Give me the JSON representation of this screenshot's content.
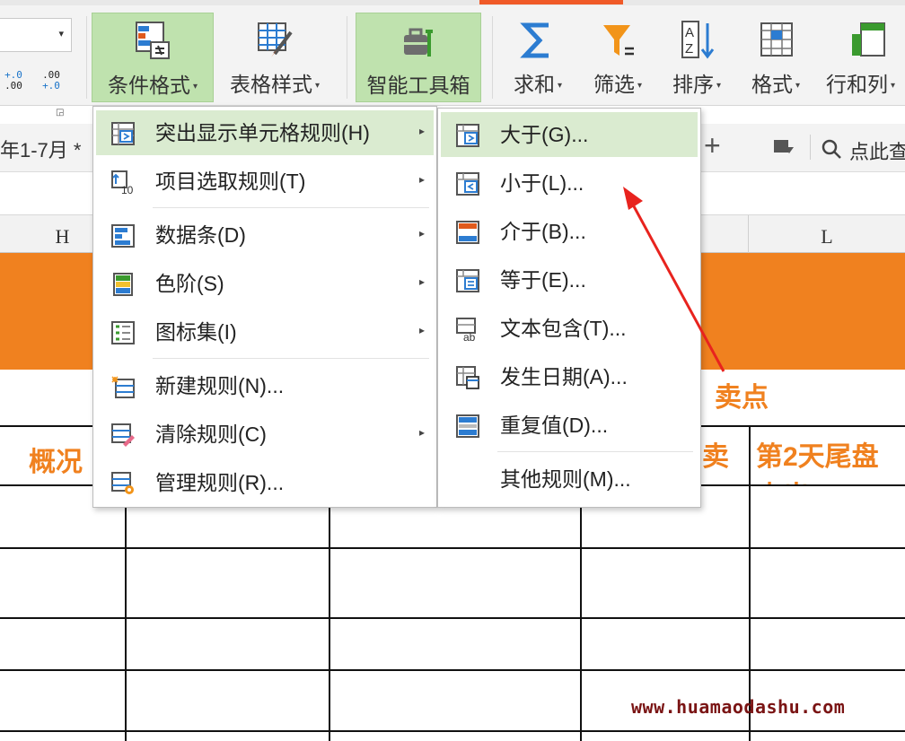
{
  "ribbon": {
    "decrease_decimal": {
      "top": "+.0",
      "bottom": ".00"
    },
    "increase_decimal": {
      "top": ".00",
      "bottom": "+.0"
    },
    "buttons": [
      {
        "label": "条件格式",
        "icon": "conditional-format-icon",
        "has_caret": true,
        "active": true
      },
      {
        "label": "表格样式",
        "icon": "table-style-icon",
        "has_caret": true,
        "active": false
      },
      {
        "label": "智能工具箱",
        "icon": "toolbox-icon",
        "has_caret": false,
        "active": true
      },
      {
        "label": "求和",
        "icon": "sum-icon",
        "has_caret": true,
        "active": false
      },
      {
        "label": "筛选",
        "icon": "filter-icon",
        "has_caret": true,
        "active": false
      },
      {
        "label": "排序",
        "icon": "sort-icon",
        "has_caret": true,
        "active": false
      },
      {
        "label": "格式",
        "icon": "format-icon",
        "has_caret": true,
        "active": false
      },
      {
        "label": "行和列",
        "icon": "rows-columns-icon",
        "has_caret": true,
        "active": false
      }
    ],
    "caret": "▾"
  },
  "tabstrip": {
    "doc_tab": "年1-7月 *",
    "add_icon": "+",
    "search_label": "点此查"
  },
  "columns": {
    "h": "H",
    "l": "L"
  },
  "grid": {
    "cell_maidian": "卖点",
    "cell_gaikuang": "概况",
    "cell_mai": "卖",
    "cell_day2": "第2天尾盘",
    "cell_day2_cut": "卖出"
  },
  "main_menu": {
    "items": [
      {
        "label": "突出显示单元格规则(H)",
        "icon": "highlight-cells-rules-icon",
        "has_submenu": true,
        "highlighted": true
      },
      {
        "label": "项目选取规则(T)",
        "icon": "top-bottom-rules-icon",
        "has_submenu": true,
        "highlighted": false
      },
      {
        "label": "数据条(D)",
        "icon": "data-bars-icon",
        "has_submenu": true,
        "highlighted": false
      },
      {
        "label": "色阶(S)",
        "icon": "color-scales-icon",
        "has_submenu": true,
        "highlighted": false
      },
      {
        "label": "图标集(I)",
        "icon": "icon-sets-icon",
        "has_submenu": true,
        "highlighted": false
      },
      {
        "label": "新建规则(N)...",
        "icon": "new-rule-icon",
        "has_submenu": false,
        "highlighted": false
      },
      {
        "label": "清除规则(C)",
        "icon": "clear-rules-icon",
        "has_submenu": true,
        "highlighted": false
      },
      {
        "label": "管理规则(R)...",
        "icon": "manage-rules-icon",
        "has_submenu": false,
        "highlighted": false
      }
    ],
    "submenu_arrow": "▸"
  },
  "sub_menu": {
    "items": [
      {
        "label": "大于(G)...",
        "icon": "greater-than-icon",
        "highlighted": true
      },
      {
        "label": "小于(L)...",
        "icon": "less-than-icon",
        "highlighted": false
      },
      {
        "label": "介于(B)...",
        "icon": "between-icon",
        "highlighted": false
      },
      {
        "label": "等于(E)...",
        "icon": "equal-to-icon",
        "highlighted": false
      },
      {
        "label": "文本包含(T)...",
        "icon": "text-contains-icon",
        "highlighted": false
      },
      {
        "label": "发生日期(A)...",
        "icon": "date-occurring-icon",
        "highlighted": false
      },
      {
        "label": "重复值(D)...",
        "icon": "duplicate-values-icon",
        "highlighted": false
      },
      {
        "label": "其他规则(M)...",
        "icon": "",
        "highlighted": false
      }
    ]
  },
  "watermark": "www.huamaodashu.com",
  "colors": {
    "accent_orange": "#f0811f",
    "menu_highlight": "#daebd0",
    "ribbon_active": "#bfe2ae",
    "annotation_arrow": "#e8231e",
    "watermark": "#7a1414"
  }
}
